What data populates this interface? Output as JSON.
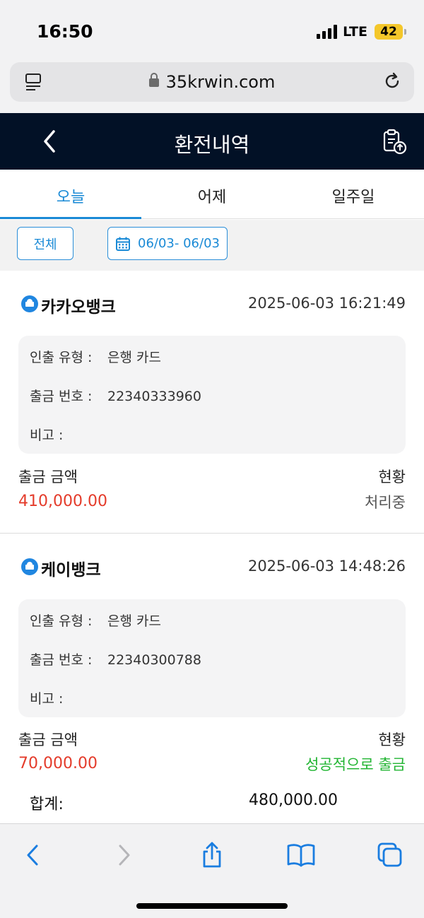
{
  "status_bar": {
    "time": "16:50",
    "network": "LTE",
    "battery": "42"
  },
  "browser": {
    "url": "35krwin.com"
  },
  "header": {
    "title": "환전내역"
  },
  "tabs": [
    {
      "label": "오늘",
      "active": true
    },
    {
      "label": "어제",
      "active": false
    },
    {
      "label": "일주일",
      "active": false
    }
  ],
  "filters": {
    "all_label": "전체",
    "date_range": "06/03- 06/03"
  },
  "labels": {
    "withdraw_type": "인출 유형 :",
    "withdraw_no": "출금 번호 :",
    "note": "비고 :",
    "amount": "출금 금액",
    "status": "현황",
    "total": "합계:"
  },
  "records": [
    {
      "bank": "카카오뱅크",
      "datetime": "2025-06-03 16:21:49",
      "withdraw_type": "은행 카드",
      "withdraw_no": "22340333960",
      "note": "",
      "amount": "410,000.00",
      "status": "처리중",
      "status_color": "#555555"
    },
    {
      "bank": "케이뱅크",
      "datetime": "2025-06-03 14:48:26",
      "withdraw_type": "은행 카드",
      "withdraw_no": "22340300788",
      "note": "",
      "amount": "70,000.00",
      "status": "성공적으로 출금",
      "status_color": "#22b533"
    }
  ],
  "total": "480,000.00",
  "colors": {
    "header_bg": "#021126",
    "accent": "#1a8ad6",
    "amount": "#e43b2a"
  }
}
